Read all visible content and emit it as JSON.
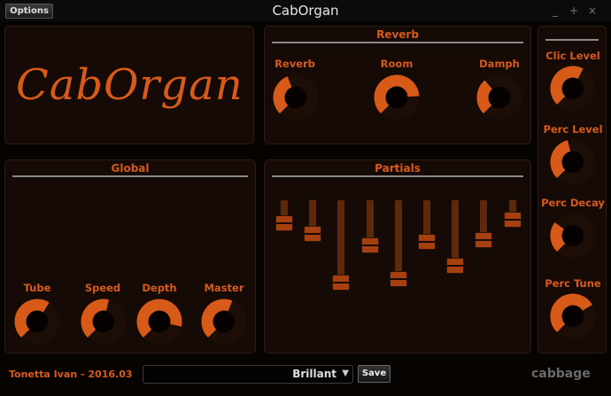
{
  "window": {
    "title": "CabOrgan",
    "options_label": "Options",
    "minimize": "_",
    "maximize": "+",
    "close": "×"
  },
  "logo": {
    "text": "CabOrgan"
  },
  "reverb": {
    "title": "Reverb",
    "knobs": [
      {
        "label": "Reverb",
        "value": 0.42
      },
      {
        "label": "Room",
        "value": 0.82
      },
      {
        "label": "Damph",
        "value": 0.35
      }
    ]
  },
  "global": {
    "title": "Global",
    "knobs": [
      {
        "label": "Tube",
        "value": 0.62
      },
      {
        "label": "Speed",
        "value": 0.55
      },
      {
        "label": "Depth",
        "value": 0.88
      },
      {
        "label": "Master",
        "value": 0.58
      }
    ]
  },
  "partials": {
    "title": "Partials",
    "values": [
      0.84,
      0.72,
      0.2,
      0.6,
      0.24,
      0.64,
      0.38,
      0.66,
      0.88
    ]
  },
  "right": {
    "knobs": [
      {
        "label": "Clic Level",
        "value": 0.6
      },
      {
        "label": "Perc Level",
        "value": 0.45
      },
      {
        "label": "Perc Decay",
        "value": 0.3
      },
      {
        "label": "Perc Tune",
        "value": 0.72
      }
    ]
  },
  "footer": {
    "author": "Tonetta Ivan - 2016.03",
    "preset": "Brillant",
    "preset_arrow": "▼",
    "save_label": "Save",
    "brand": "cabbage"
  },
  "colors": {
    "accent": "#d85a18",
    "knob_track": "#1c0e07",
    "knob_hole": "#050201",
    "fader_thumb": "#a7400f"
  }
}
